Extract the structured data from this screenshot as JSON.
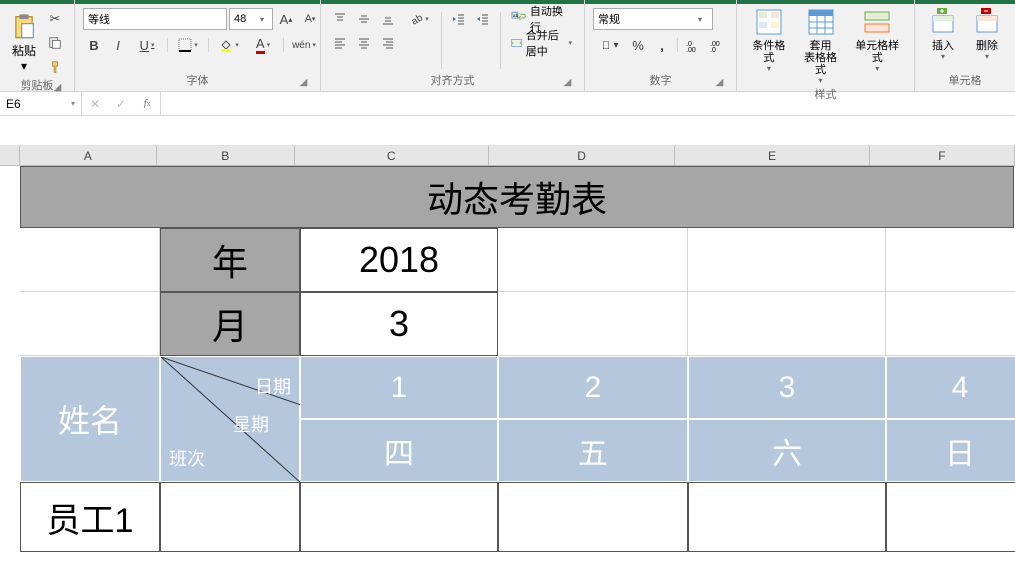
{
  "ribbon": {
    "clipboard": {
      "paste": "粘贴",
      "group_label": "剪贴板"
    },
    "font": {
      "name": "等线",
      "size": "48",
      "group_label": "字体",
      "bold": "B",
      "italic": "I",
      "underline": "U",
      "phonetic": "wén"
    },
    "alignment": {
      "wrap_text": "自动换行",
      "merge_center": "合并后居中",
      "group_label": "对齐方式"
    },
    "number": {
      "format": "常规",
      "group_label": "数字"
    },
    "styles": {
      "cond_format": "条件格式",
      "table_format": "套用\n表格格式",
      "cell_styles": "单元格样式",
      "group_label": "样式"
    },
    "cells": {
      "insert": "插入",
      "delete": "删除",
      "group_label": "单元格"
    }
  },
  "namebox": {
    "value": "E6"
  },
  "columns": [
    "A",
    "B",
    "C",
    "D",
    "E",
    "F"
  ],
  "sheet": {
    "title": "动态考勤表",
    "year_label": "年",
    "year_value": "2018",
    "month_label": "月",
    "month_value": "3",
    "name_header": "姓名",
    "diag": {
      "date": "日期",
      "week": "星期",
      "shift": "班次"
    },
    "days": [
      "1",
      "2",
      "3",
      "4"
    ],
    "weekdays": [
      "四",
      "五",
      "六",
      "日"
    ],
    "employee1": "员工1"
  }
}
